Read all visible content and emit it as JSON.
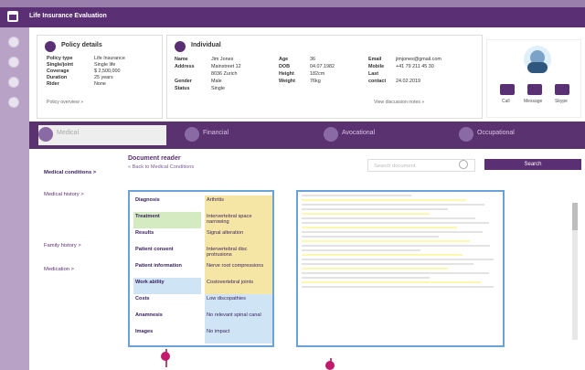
{
  "app": {
    "title": "Life Insurance Evaluation"
  },
  "policy": {
    "title": "Policy details",
    "rows": [
      {
        "k": "Policy type",
        "v": "Life Insurance"
      },
      {
        "k": "Single/joint",
        "v": "Single life"
      },
      {
        "k": "Coverage",
        "v": "$ 2,500,000"
      },
      {
        "k": "Duration",
        "v": "25 years"
      },
      {
        "k": "Rider",
        "v": "None"
      }
    ],
    "overview": "Policy overview »"
  },
  "individual": {
    "title": "Individual",
    "name_label": "Name",
    "name": "Jim Jones",
    "address_label": "Address",
    "address1": "Mainstreet 12",
    "address2": "8036 Zurich",
    "gender_label": "Gender",
    "gender": "Male",
    "status_label": "Status",
    "status": "Single",
    "age_label": "Age",
    "age": "36",
    "dob_label": "DOB",
    "dob": "04.07.1982",
    "height_label": "Height",
    "height": "182cm",
    "weight_label": "Weight",
    "weight": "76kg",
    "email_label": "Email",
    "email": "jimjones@gmail.com",
    "mobile_label": "Mobile",
    "mobile": "+41 79 211 45 30",
    "lastcontact_label": "Last contact",
    "lastcontact": "24.02.2019",
    "notes": "View discussion notes »"
  },
  "contact": {
    "call": "Call",
    "message": "Message",
    "skype": "Skype"
  },
  "tabs": [
    {
      "label": "Medical"
    },
    {
      "label": "Financial"
    },
    {
      "label": "Avocational"
    },
    {
      "label": "Occupational"
    }
  ],
  "leftnav": [
    "Medical conditions >",
    "Medical history >",
    "Family history >",
    "Medication >"
  ],
  "reader": {
    "title": "Document reader",
    "back": "« Back to Medical Conditions",
    "search_placeholder": "Search document",
    "search_button": "Search"
  },
  "grid": [
    {
      "k": "Diagnosis",
      "v": "Arthritis"
    },
    {
      "k": "Treatment",
      "v": "Intervertebral space narrowing"
    },
    {
      "k": "Results",
      "v": "Signal alteration"
    },
    {
      "k": "Patient consent",
      "v": "Intervertebral disc protrusions"
    },
    {
      "k": "Patient information",
      "v": "Nerve root compressions"
    },
    {
      "k": "Work ability",
      "v": "Costovertebral joints"
    },
    {
      "k": "Costs",
      "v": "Low discopathies"
    },
    {
      "k": "Anamnesis",
      "v": "No relevant spinal canal"
    },
    {
      "k": "Images",
      "v": "No impact"
    }
  ]
}
